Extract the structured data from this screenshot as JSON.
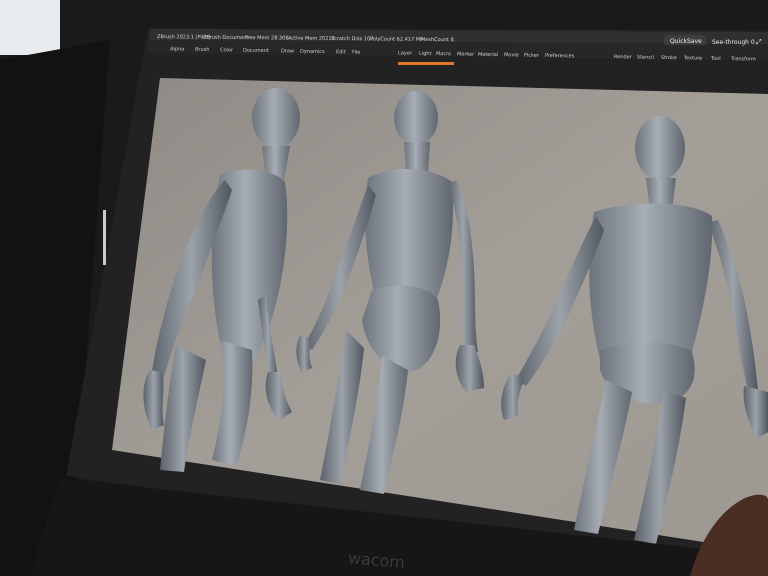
{
  "titlebar": {
    "segments": [
      "ZBrush 2023.1 [Pilot]",
      "ZBrush Document",
      "Free Mem 28.308",
      "Active Mem 20217",
      "Scratch Disk 107",
      "PolyCount 62.417 MP",
      "MeshCount 8"
    ],
    "quicksave": "QuickSave",
    "see_through": "See-through 0"
  },
  "menubar": {
    "items": [
      "Alpha",
      "Brush",
      "Color",
      "Document",
      "Draw",
      "Dynamics",
      "Edit",
      "File",
      "Layer",
      "Light",
      "Macro",
      "Marker",
      "Material",
      "Movie",
      "Picker",
      "Preferences",
      "Render",
      "Stencil",
      "Stroke",
      "Texture",
      "Tool",
      "Transform"
    ]
  },
  "brand": "wacom",
  "colors": {
    "viewport": "#9a958f",
    "ui_bar": "#2b2b2b",
    "accent": "#e4762c",
    "bezel": "#1a1a1a",
    "sculpt": "#8c939c"
  }
}
